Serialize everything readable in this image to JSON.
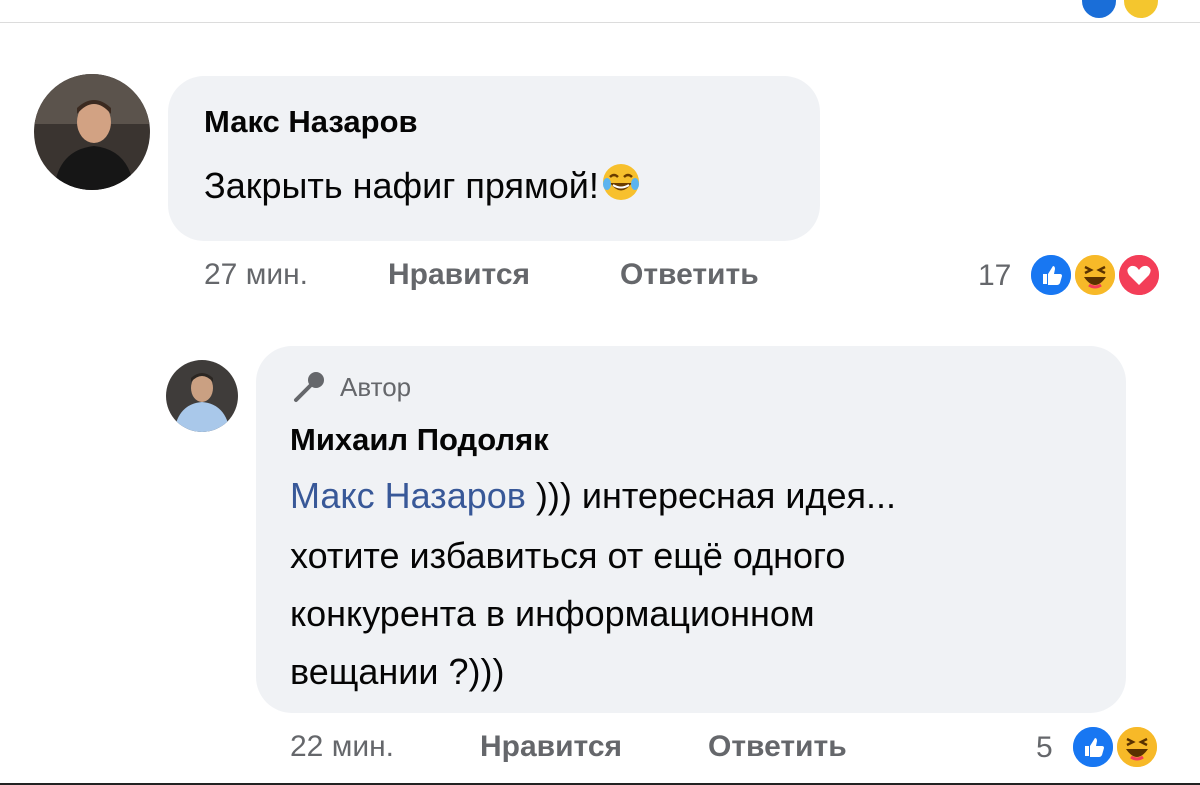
{
  "comment": {
    "author": "Макс Назаров",
    "text": "Закрыть нафиг прямой!",
    "text_emoji": "laughing-tears-emoji",
    "time": "27 мин.",
    "like_label": "Нравится",
    "reply_label": "Ответить",
    "reaction_count": "17",
    "reactions": [
      "like",
      "haha",
      "love"
    ]
  },
  "reply": {
    "badge": "Автор",
    "badge_icon": "microphone-icon",
    "author": "Михаил Подоляк",
    "mention": "Макс Назаров",
    "line1_rest": " ))) интересная идея...",
    "line2": "хотите избавиться от ещё одного",
    "line3": "конкурента в информационном",
    "line4": "вещании ?)))",
    "time": "22 мин.",
    "like_label": "Нравится",
    "reply_label": "Ответить",
    "reaction_count": "5",
    "reactions": [
      "like",
      "haha"
    ]
  },
  "colors": {
    "bubble": "#f0f2f5",
    "meta_text": "#65676b",
    "mention": "#385898",
    "like_blue": "#1877f2",
    "love_red": "#f33e58",
    "haha_yellow": "#f7b928"
  }
}
